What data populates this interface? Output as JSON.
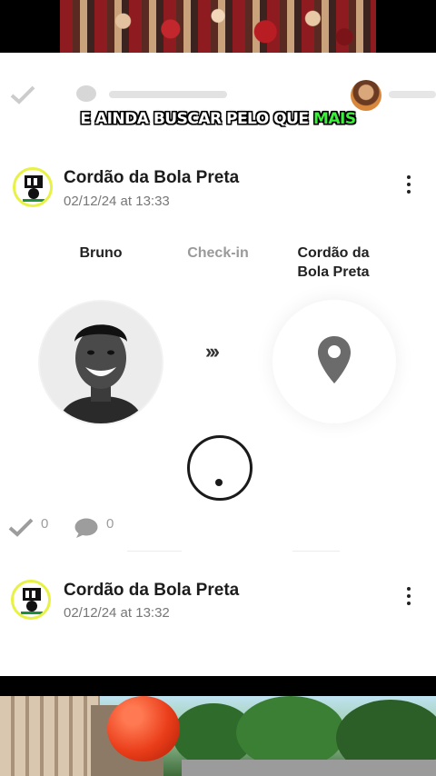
{
  "caption": {
    "text_main": "E AINDA BUSCAR PELO QUE ",
    "text_highlight": "MAIS",
    "highlight_color": "#3cf03c"
  },
  "posts": [
    {
      "title": "Cordão da Bola Preta",
      "date": "02/12/24 at 13:33"
    },
    {
      "title": "Cordão da Bola Preta",
      "date": "02/12/24 at 13:32"
    }
  ],
  "checkin": {
    "user_name": "Bruno",
    "action_label": "Check-in",
    "place_line1": "Cordão da",
    "place_line2": "Bola Preta",
    "arrows": "›››"
  },
  "actions": {
    "likes_count": "0",
    "comments_count": "0"
  },
  "colors": {
    "logo_ring": "#e8f244",
    "pin": "#6b6b6b",
    "balloon": "#ea3d1a"
  }
}
